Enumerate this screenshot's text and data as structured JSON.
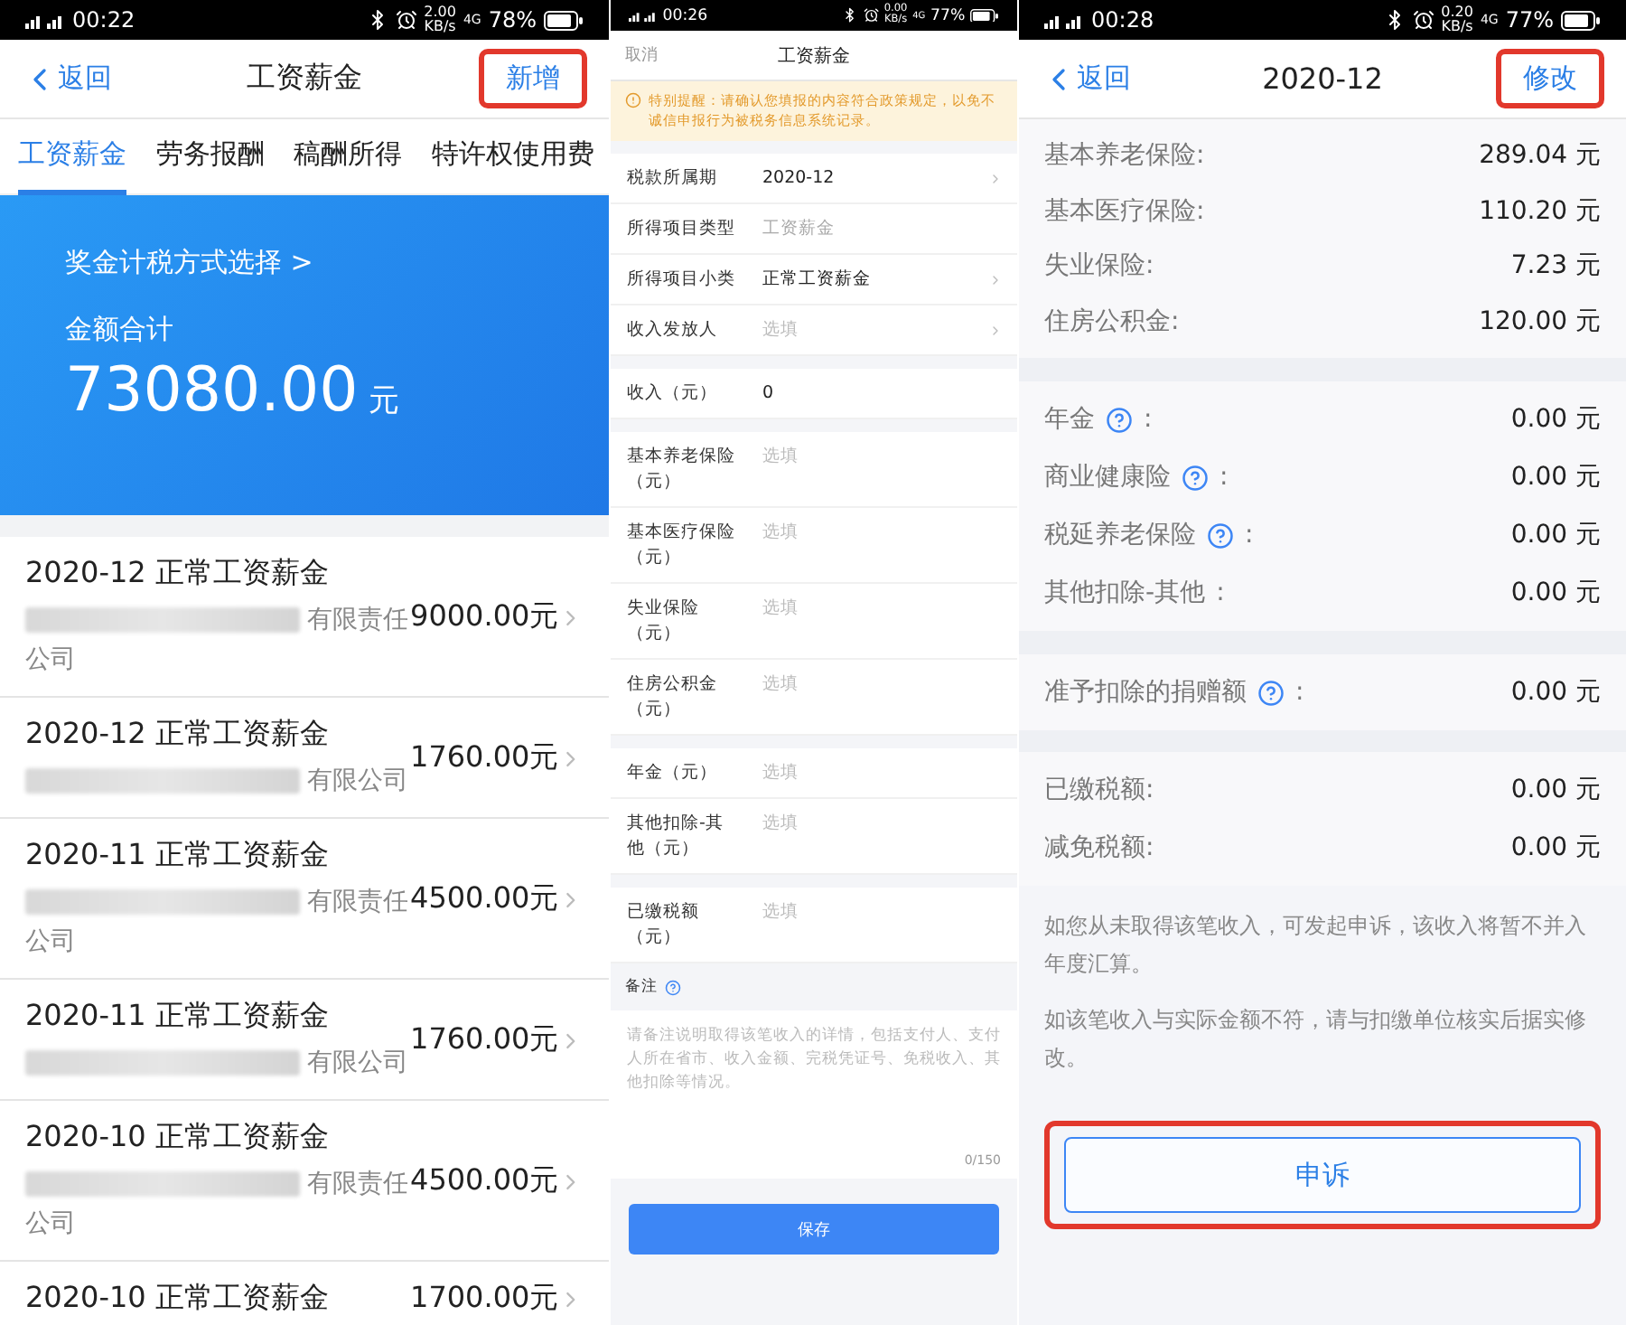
{
  "income_list_screen": {
    "status_bar": {
      "time": "00:22",
      "net_speed": "2.00",
      "speed_unit": "KB/s",
      "network": "4G",
      "battery": "78%"
    },
    "nav": {
      "back": "返回",
      "title": "工资薪金",
      "action": {
        "label": "新增",
        "highlighted": true
      }
    },
    "tabs": [
      {
        "label": "工资薪金",
        "selected": true
      },
      {
        "label": "劳务报酬",
        "selected": false
      },
      {
        "label": "稿酬所得",
        "selected": false
      },
      {
        "label": "特许权使用费",
        "selected": false
      }
    ],
    "summary": {
      "link": "奖金计税方式选择 >",
      "total_label": "金额合计",
      "total": "73080.00",
      "unit": "元"
    },
    "records": [
      {
        "title": "2020-12 正常工资薪金",
        "payer": "有限责任公司",
        "amount": "9000.00元"
      },
      {
        "title": "2020-12 正常工资薪金",
        "payer": "有限公司",
        "amount": "1760.00元"
      },
      {
        "title": "2020-11 正常工资薪金",
        "payer": "有限责任公司",
        "amount": "4500.00元"
      },
      {
        "title": "2020-11 正常工资薪金",
        "payer": "有限公司",
        "amount": "1760.00元"
      },
      {
        "title": "2020-10 正常工资薪金",
        "payer": "有限责任公司",
        "amount": "4500.00元"
      },
      {
        "title": "2020-10 正常工资薪金",
        "amount": "1700.00元"
      }
    ]
  },
  "add_income_screen": {
    "status_bar": {
      "time": "00:26",
      "net_speed": "0.00",
      "speed_unit": "KB/s",
      "network": "4G",
      "battery": "77%"
    },
    "nav": {
      "cancel": "取消",
      "title": "工资薪金"
    },
    "notice": "特别提醒：请确认您填报的内容符合政策规定，以免不诚信申报行为被税务信息系统记录。",
    "groups": [
      [
        {
          "label": "税款所属期",
          "value": "2020-12",
          "chevron": true
        },
        {
          "label": "所得项目类型",
          "value": "工资薪金",
          "disabled": true,
          "chevron": false
        },
        {
          "label": "所得项目小类",
          "value": "正常工资薪金",
          "chevron": true
        },
        {
          "label": "收入发放人",
          "placeholder": "选填",
          "chevron": true
        }
      ],
      [
        {
          "label": "收入（元）",
          "value": "0",
          "chevron": false
        }
      ],
      [
        {
          "label": "基本养老保险（元）",
          "placeholder": "选填",
          "chevron": false
        },
        {
          "label": "基本医疗保险（元）",
          "placeholder": "选填",
          "chevron": false
        },
        {
          "label": "失业保险（元）",
          "placeholder": "选填",
          "chevron": false
        },
        {
          "label": "住房公积金（元）",
          "placeholder": "选填",
          "chevron": false
        }
      ],
      [
        {
          "label": "年金（元）",
          "placeholder": "选填",
          "chevron": false
        },
        {
          "label": "其他扣除-其他（元）",
          "placeholder": "选填",
          "chevron": false
        }
      ],
      [
        {
          "label": "已缴税额（元）",
          "placeholder": "选填",
          "chevron": false
        }
      ]
    ],
    "remark": {
      "label": "备注",
      "placeholder": "请备注说明取得该笔收入的详情，包括支付人、支付人所在省市、收入金额、完税凭证号、免税收入、其他扣除等情况。",
      "counter": "0/150"
    },
    "save_button": "保存"
  },
  "income_detail_screen": {
    "status_bar": {
      "time": "00:28",
      "net_speed": "0.20",
      "speed_unit": "KB/s",
      "network": "4G",
      "battery": "77%"
    },
    "nav": {
      "back": "返回",
      "title": "2020-12",
      "action": {
        "label": "修改",
        "highlighted": true
      }
    },
    "groups": [
      [
        {
          "label": "基本养老保险:",
          "value": "289.04 元"
        },
        {
          "label": "基本医疗保险:",
          "value": "110.20 元"
        },
        {
          "label": "失业保险:",
          "value": "7.23 元"
        },
        {
          "label": "住房公积金:",
          "value": "120.00 元"
        }
      ],
      [
        {
          "label": "年金",
          "help": true,
          "suffix": ":",
          "value": "0.00 元"
        },
        {
          "label": "商业健康险",
          "help": true,
          "suffix": ":",
          "value": "0.00 元"
        },
        {
          "label": "税延养老保险",
          "help": true,
          "suffix": ":",
          "value": "0.00 元"
        },
        {
          "label": "其他扣除-其他",
          "suffix": ":",
          "value": "0.00 元"
        }
      ],
      [
        {
          "label": "准予扣除的捐赠额",
          "help": true,
          "suffix": ":",
          "value": "0.00 元"
        }
      ],
      [
        {
          "label": "已缴税额:",
          "value": "0.00 元"
        },
        {
          "label": "减免税额:",
          "value": "0.00 元"
        }
      ]
    ],
    "notes": [
      "如您从未取得该笔收入，可发起申诉，该收入将暂不并入年度汇算。",
      "如该笔收入与实际金额不符，请与扣缴单位核实后据实修改。"
    ],
    "appeal_button": {
      "label": "申诉",
      "highlighted": true
    }
  }
}
